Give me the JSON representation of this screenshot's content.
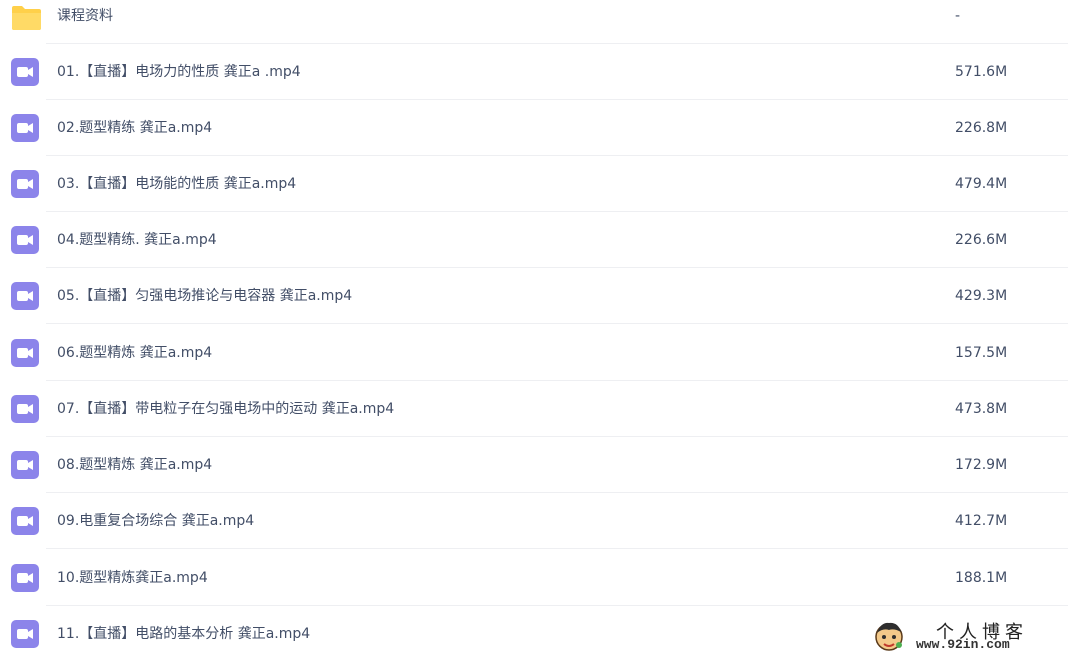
{
  "colors": {
    "folder_icon": "#ffd04a",
    "video_icon": "#8c84ea",
    "text": "#424e67",
    "divider": "#eeeff2"
  },
  "folder": {
    "name": "课程资料",
    "size": "-",
    "icon": "folder-icon"
  },
  "files": [
    {
      "name": "01.【直播】电场力的性质 龚正a .mp4",
      "size": "571.6M",
      "icon": "video-file-icon"
    },
    {
      "name": "02.题型精练 龚正a.mp4",
      "size": "226.8M",
      "icon": "video-file-icon"
    },
    {
      "name": "03.【直播】电场能的性质 龚正a.mp4",
      "size": "479.4M",
      "icon": "video-file-icon"
    },
    {
      "name": "04.题型精练. 龚正a.mp4",
      "size": "226.6M",
      "icon": "video-file-icon"
    },
    {
      "name": "05.【直播】匀强电场推论与电容器 龚正a.mp4",
      "size": "429.3M",
      "icon": "video-file-icon"
    },
    {
      "name": "06.题型精炼 龚正a.mp4",
      "size": "157.5M",
      "icon": "video-file-icon"
    },
    {
      "name": "07.【直播】带电粒子在匀强电场中的运动 龚正a.mp4",
      "size": "473.8M",
      "icon": "video-file-icon"
    },
    {
      "name": "08.题型精炼 龚正a.mp4",
      "size": "172.9M",
      "icon": "video-file-icon"
    },
    {
      "name": "09.电重复合场综合 龚正a.mp4",
      "size": "412.7M",
      "icon": "video-file-icon"
    },
    {
      "name": "10.题型精炼龚正a.mp4",
      "size": "188.1M",
      "icon": "video-file-icon"
    },
    {
      "name": "11.【直播】电路的基本分析 龚正a.mp4",
      "size": "",
      "icon": "video-file-icon"
    }
  ],
  "watermark": {
    "title": "个人博客",
    "url": "www.92in.com",
    "icon": "mascot-logo-icon"
  }
}
